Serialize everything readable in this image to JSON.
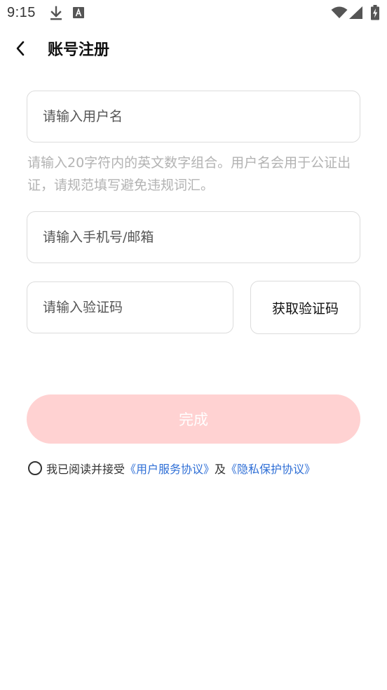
{
  "status_bar": {
    "time": "9:15",
    "icons": [
      "download-icon",
      "a-icon",
      "wifi-icon",
      "signal-icon",
      "battery-charging-icon"
    ]
  },
  "header": {
    "back_icon": "chevron-left-icon",
    "title": "账号注册"
  },
  "form": {
    "username": {
      "placeholder": "请输入用户名",
      "value": ""
    },
    "username_hint": "请输入20字符内的英文数字组合。用户名会用于公证出证，请规范填写避免违规词汇。",
    "phone_email": {
      "placeholder": "请输入手机号/邮箱",
      "value": ""
    },
    "verification_code": {
      "placeholder": "请输入验证码",
      "value": ""
    },
    "get_code_label": "获取验证码",
    "submit_label": "完成"
  },
  "agreement": {
    "checked": false,
    "prefix": "我已阅读并接受",
    "user_agreement": "《用户服务协议》",
    "conjunction": "及",
    "privacy_policy": "《隐私保护协议》"
  },
  "colors": {
    "submit_background": "#ffd2d2",
    "link": "#2f6fd6",
    "hint": "#b3b3b3",
    "border": "#dcdcdc"
  }
}
